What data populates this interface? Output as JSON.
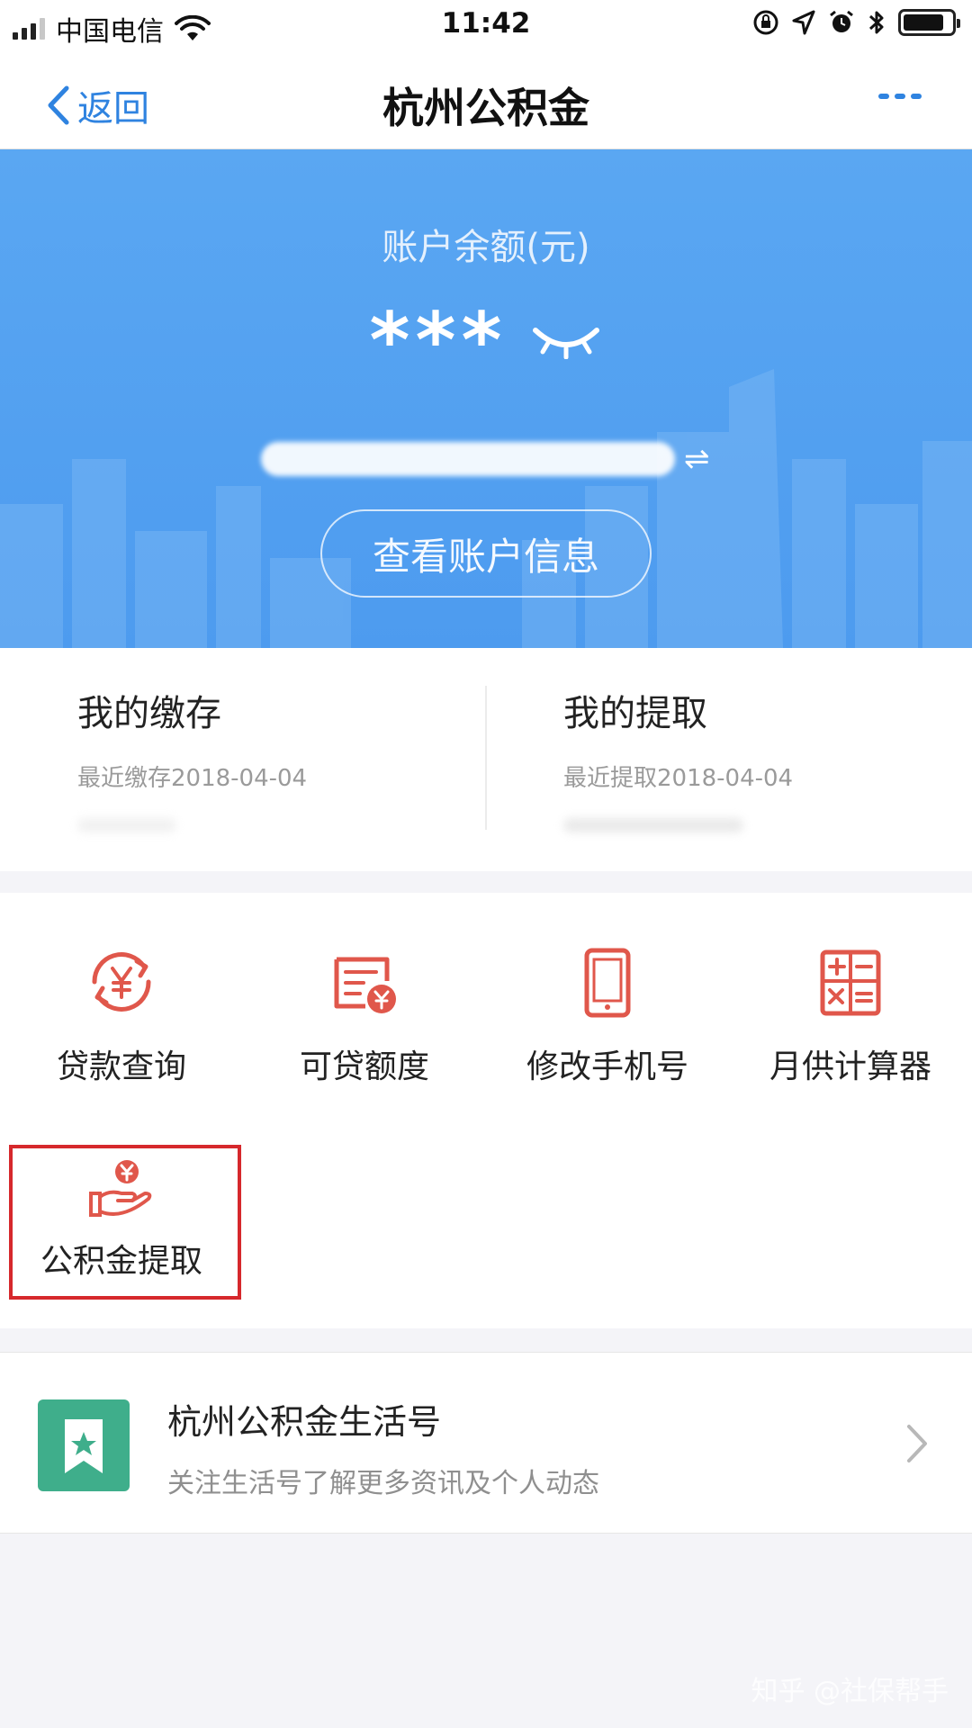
{
  "status_bar": {
    "carrier": "中国电信",
    "time": "11:42",
    "battery_level": 0.85
  },
  "nav": {
    "back_label": "返回",
    "title": "杭州公积金"
  },
  "account": {
    "balance_label": "账户余额(元)",
    "balance_masked": "***",
    "account_number_redacted": "******",
    "view_button": "查看账户信息"
  },
  "summary": {
    "deposit": {
      "title": "我的缴存",
      "recent": "最近缴存2018-04-04"
    },
    "withdraw": {
      "title": "我的提取",
      "recent": "最近提取2018-04-04"
    }
  },
  "features": [
    {
      "label": "贷款查询",
      "icon": "loan-query-icon"
    },
    {
      "label": "可贷额度",
      "icon": "loan-quota-icon"
    },
    {
      "label": "修改手机号",
      "icon": "phone-icon"
    },
    {
      "label": "月供计算器",
      "icon": "calculator-icon"
    },
    {
      "label": "公积金提取",
      "icon": "withdraw-hand-icon"
    }
  ],
  "life_account": {
    "title": "杭州公积金生活号",
    "subtitle": "关注生活号了解更多资讯及个人动态"
  },
  "watermark": "知乎 @社保帮手",
  "colors": {
    "accent_blue": "#2f83e0",
    "hero_blue": "#5aa7f2",
    "icon_red": "#e0574b",
    "highlight_red": "#d6282c",
    "life_green": "#3fae8b"
  }
}
